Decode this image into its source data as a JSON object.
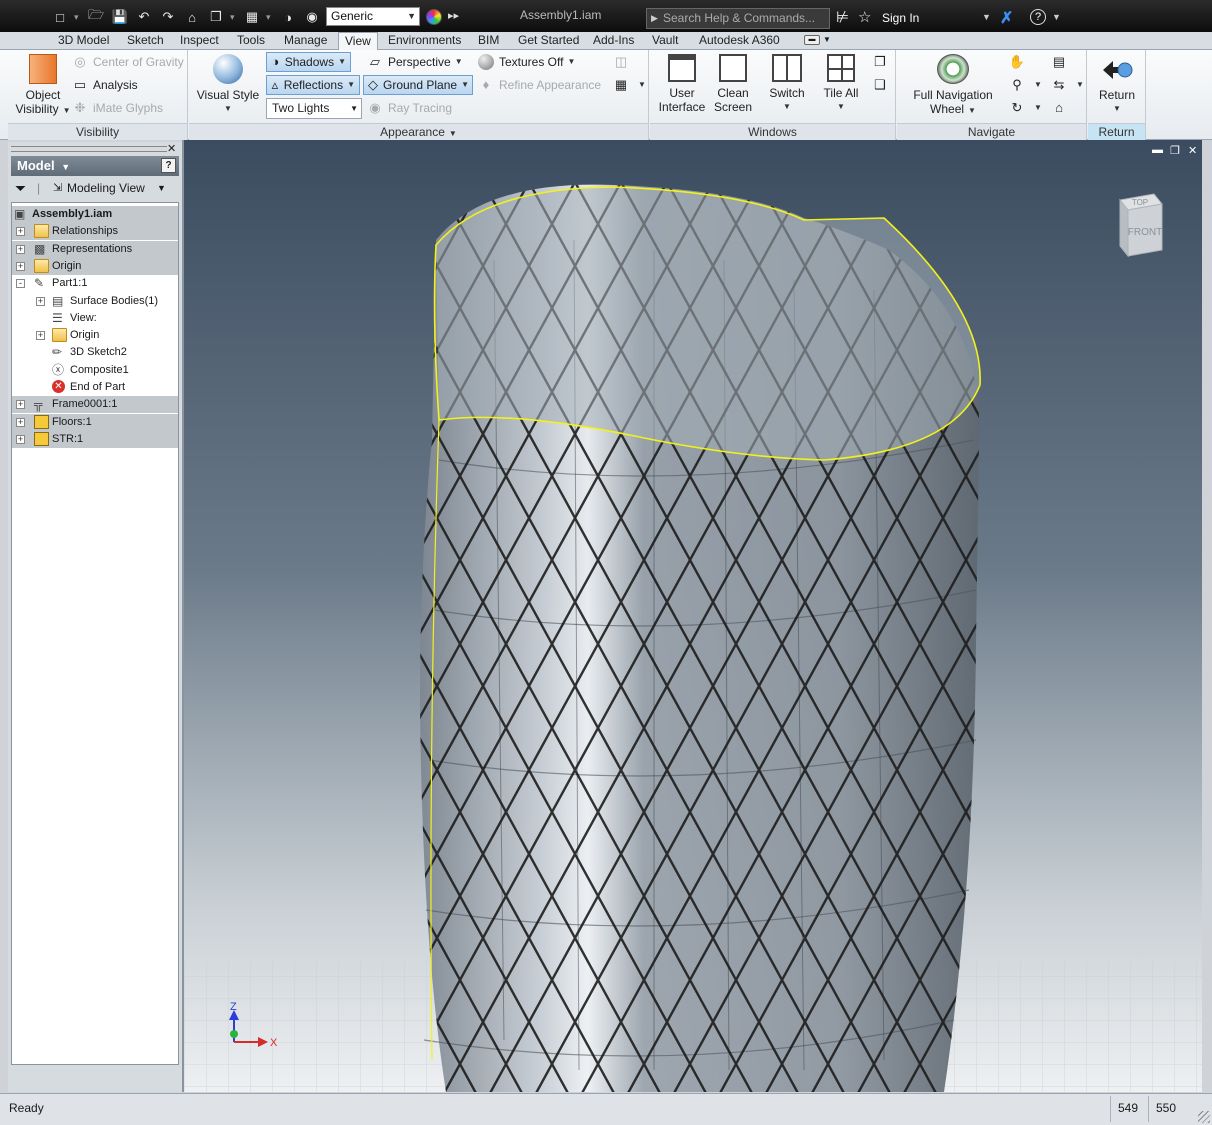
{
  "window": {
    "title": "Assembly1.iam"
  },
  "qat": {
    "material": "Generic",
    "icons": [
      "new-icon",
      "open-icon",
      "save-icon",
      "undo-icon",
      "redo-icon",
      "home-icon",
      "projects-icon",
      "update-icon",
      "select-icon",
      "appearance-icon"
    ]
  },
  "help": {
    "search_placeholder": "Search Help & Commands...",
    "sign_in": "Sign In"
  },
  "tabs": [
    "3D Model",
    "Sketch",
    "Inspect",
    "Tools",
    "Manage",
    "View",
    "Environments",
    "BIM",
    "Get Started",
    "Add-Ins",
    "Vault",
    "Autodesk A360"
  ],
  "active_tab": "View",
  "ribbon": {
    "visibility": {
      "title": "Visibility",
      "object_visibility_1": "Object",
      "object_visibility_2": "Visibility",
      "center_of_gravity": "Center of Gravity",
      "analysis": "Analysis",
      "imate_glyphs": "iMate Glyphs"
    },
    "appearance": {
      "title": "Appearance",
      "visual_style": "Visual Style",
      "shadows": "Shadows",
      "reflections": "Reflections",
      "lighting": "Two Lights",
      "perspective": "Perspective",
      "ground_plane": "Ground Plane",
      "ray_tracing": "Ray Tracing",
      "textures": "Textures Off",
      "refine_appearance": "Refine Appearance"
    },
    "windows": {
      "title": "Windows",
      "user_interface_1": "User",
      "user_interface_2": "Interface",
      "clean_screen_1": "Clean",
      "clean_screen_2": "Screen",
      "switch": "Switch",
      "tile_all": "Tile All"
    },
    "navigate": {
      "title": "Navigate",
      "full_nav_wheel_1": "Full Navigation",
      "full_nav_wheel_2": "Wheel"
    },
    "return": {
      "title": "Return",
      "label": "Return"
    }
  },
  "browser": {
    "title": "Model",
    "view_label": "Modeling View",
    "tree": [
      {
        "label": "Assembly1.iam",
        "level": 0,
        "icon": "assembly-icon",
        "grey": true,
        "bold": true
      },
      {
        "label": "Relationships",
        "level": 1,
        "icon": "folder-icon",
        "grey": true,
        "expander": "+"
      },
      {
        "label": "Representations",
        "level": 1,
        "icon": "representations-icon",
        "grey": true,
        "expander": "+"
      },
      {
        "label": "Origin",
        "level": 1,
        "icon": "folder-icon",
        "grey": true,
        "expander": "+"
      },
      {
        "label": "Part1:1",
        "level": 1,
        "icon": "part-icon",
        "grey": false,
        "expander": "-"
      },
      {
        "label": "Surface Bodies(1)",
        "level": 2,
        "icon": "surface-bodies-icon",
        "grey": false,
        "expander": "+"
      },
      {
        "label": "View:",
        "level": 2,
        "icon": "view-icon",
        "grey": false
      },
      {
        "label": "Origin",
        "level": 2,
        "icon": "folder-icon",
        "grey": false,
        "expander": "+"
      },
      {
        "label": "3D Sketch2",
        "level": 2,
        "icon": "sketch3d-icon",
        "grey": false
      },
      {
        "label": "Composite1",
        "level": 2,
        "icon": "composite-icon",
        "grey": false
      },
      {
        "label": "End of Part",
        "level": 2,
        "icon": "end-of-part-icon",
        "grey": false
      },
      {
        "label": "Frame0001:1",
        "level": 1,
        "icon": "frame-icon",
        "grey": true,
        "expander": "+"
      },
      {
        "label": "Floors:1",
        "level": 1,
        "icon": "part-cube-icon",
        "grey": true,
        "expander": "+"
      },
      {
        "label": "STR:1",
        "level": 1,
        "icon": "part-cube-icon",
        "grey": true,
        "expander": "+"
      }
    ]
  },
  "viewcube": {
    "top": "TOP",
    "front": "FRONT"
  },
  "axis": {
    "z": "Z",
    "x": "X"
  },
  "status": {
    "text": "Ready",
    "num1": "549",
    "num2": "550"
  },
  "colors": {
    "accent": "#3d8ef0",
    "viewport_top": "#3b4c60",
    "selection": "#f2f21a"
  }
}
